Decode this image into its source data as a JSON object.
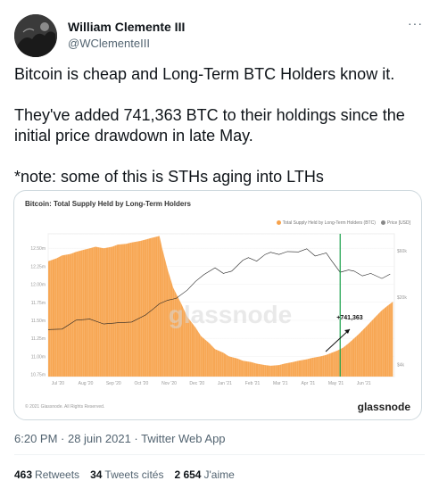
{
  "author": {
    "name": "William Clemente III",
    "handle": "@WClementeIII"
  },
  "more_icon": "···",
  "tweet": {
    "line1": "Bitcoin is cheap and Long-Term BTC Holders know it.",
    "line2": "They've added 741,363 BTC to their holdings since the initial price drawdown in late May.",
    "line3": "*note: some of this is STHs aging into LTHs"
  },
  "card": {
    "copyright": "© 2021 Glassnode. All Rights Reserved.",
    "brand": "glassnode",
    "watermark": "glassnode"
  },
  "chart_data": {
    "type": "line",
    "title": "Bitcoin: Total Supply Held by Long-Term Holders",
    "annotation": "+741,363",
    "x_ticks": [
      "Jul '20",
      "Aug '20",
      "Sep '20",
      "Oct '20",
      "Nov '20",
      "Dec '20",
      "Jan '21",
      "Feb '21",
      "Mar '21",
      "Apr '21",
      "May '21",
      "Jun '21"
    ],
    "y_left_ticks": [
      "10.75m",
      "11.00m",
      "11.25m",
      "11.50m",
      "11.75m",
      "12.00m",
      "12.25m",
      "12.50m"
    ],
    "y_right_ticks": [
      "$4k",
      "$20k",
      "$60k"
    ],
    "ylim_left": [
      10.72,
      12.7
    ],
    "series": [
      {
        "name": "Total Supply Held by Long-Term Holders (BTC)",
        "color": "#f7a24b",
        "x": [
          0,
          0.3,
          0.5,
          0.8,
          1.0,
          1.3,
          1.5,
          1.7,
          2.0,
          2.3,
          2.5,
          2.8,
          3.0,
          3.3,
          3.5,
          3.7,
          3.9,
          4.0,
          4.1,
          4.3,
          4.5,
          4.8,
          5.0,
          5.3,
          5.5,
          5.8,
          6.0,
          6.3,
          6.5,
          6.8,
          7.0,
          7.3,
          7.5,
          7.8,
          8.0,
          8.3,
          8.5,
          8.8,
          9.0,
          9.3,
          9.5,
          9.8,
          10.0,
          10.2,
          10.4,
          10.6,
          10.8,
          11.0,
          11.2,
          11.4,
          11.6,
          11.8,
          12.0,
          12.2,
          12.4
        ],
        "values": [
          12.32,
          12.36,
          12.4,
          12.42,
          12.45,
          12.48,
          12.5,
          12.52,
          12.5,
          12.52,
          12.55,
          12.56,
          12.58,
          12.6,
          12.62,
          12.64,
          12.66,
          12.67,
          12.5,
          12.2,
          11.95,
          11.72,
          11.55,
          11.4,
          11.28,
          11.18,
          11.1,
          11.05,
          11.0,
          10.97,
          10.94,
          10.92,
          10.9,
          10.88,
          10.87,
          10.88,
          10.9,
          10.92,
          10.94,
          10.96,
          10.98,
          11.0,
          11.02,
          11.05,
          11.08,
          11.12,
          11.18,
          11.25,
          11.32,
          11.4,
          11.48,
          11.56,
          11.64,
          11.7,
          11.76
        ]
      },
      {
        "name": "Price [USD]",
        "color": "#888888",
        "x": [
          0,
          0.5,
          1.0,
          1.5,
          2.0,
          2.5,
          3.0,
          3.5,
          3.8,
          4.0,
          4.3,
          4.6,
          5.0,
          5.3,
          5.6,
          6.0,
          6.3,
          6.6,
          7.0,
          7.2,
          7.5,
          7.8,
          8.0,
          8.3,
          8.6,
          9.0,
          9.3,
          9.6,
          10.0,
          10.2,
          10.5,
          10.8,
          11.0,
          11.3,
          11.6,
          12.0,
          12.3
        ],
        "values": [
          9200,
          9300,
          11500,
          11800,
          10500,
          10800,
          11000,
          13000,
          15200,
          17000,
          18500,
          19300,
          23500,
          29000,
          34000,
          40000,
          35000,
          37000,
          48000,
          51000,
          47000,
          55000,
          58000,
          55000,
          59000,
          58500,
          63000,
          53000,
          57000,
          47000,
          36000,
          38000,
          37000,
          33000,
          35000,
          31000,
          34500
        ]
      }
    ],
    "marker_x": 10.5
  }
}
